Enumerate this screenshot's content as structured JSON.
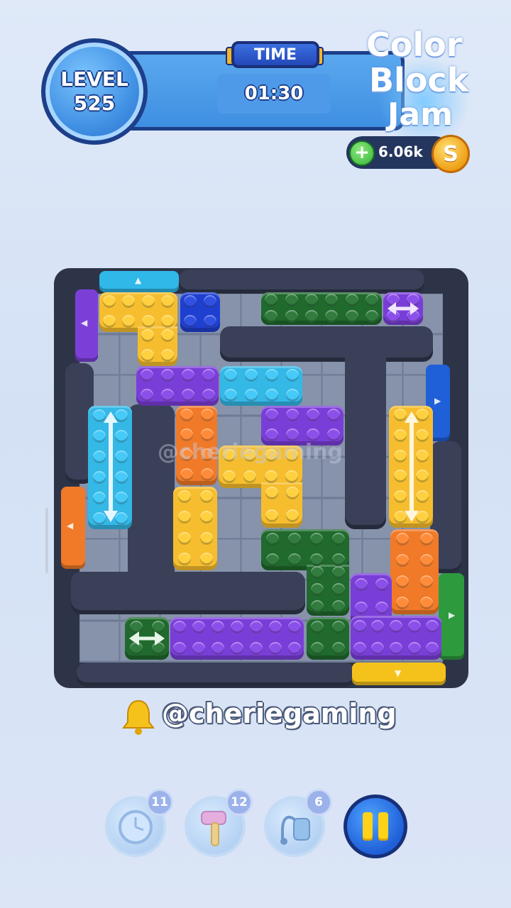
{
  "hud": {
    "level_label": "LEVEL",
    "level_number": "525",
    "time_label": "TIME",
    "time_value": "01:30",
    "coins": "6.06k",
    "coin_symbol": "S",
    "add_symbol": "+"
  },
  "logo": {
    "line1": "Color",
    "line2": "Block",
    "line3": "Jam"
  },
  "board": {
    "watermark": "@cheriegaming",
    "exit_gates": [
      {
        "color": "#2fb8e8",
        "side": "top"
      },
      {
        "color": "#7b3fd8",
        "side": "left"
      },
      {
        "color": "#1f5fd8",
        "side": "right"
      },
      {
        "color": "#f07a28",
        "side": "left"
      },
      {
        "color": "#2e9a3e",
        "side": "right"
      },
      {
        "color": "#f5c21c",
        "side": "bottom"
      }
    ]
  },
  "colors": {
    "yellow": "#f6be2e",
    "blue": "#1f3fd0",
    "green": "#1f6a2c",
    "purple": "#7a3ed8",
    "cyan": "#34b8e6",
    "orange": "#f07a28"
  },
  "footer": {
    "handle": "@cheriegaming",
    "bell_icon": "bell-icon"
  },
  "boosters": [
    {
      "name": "freeze-clock",
      "count": "11"
    },
    {
      "name": "hammer",
      "count": "12"
    },
    {
      "name": "vacuum",
      "count": "6"
    }
  ]
}
